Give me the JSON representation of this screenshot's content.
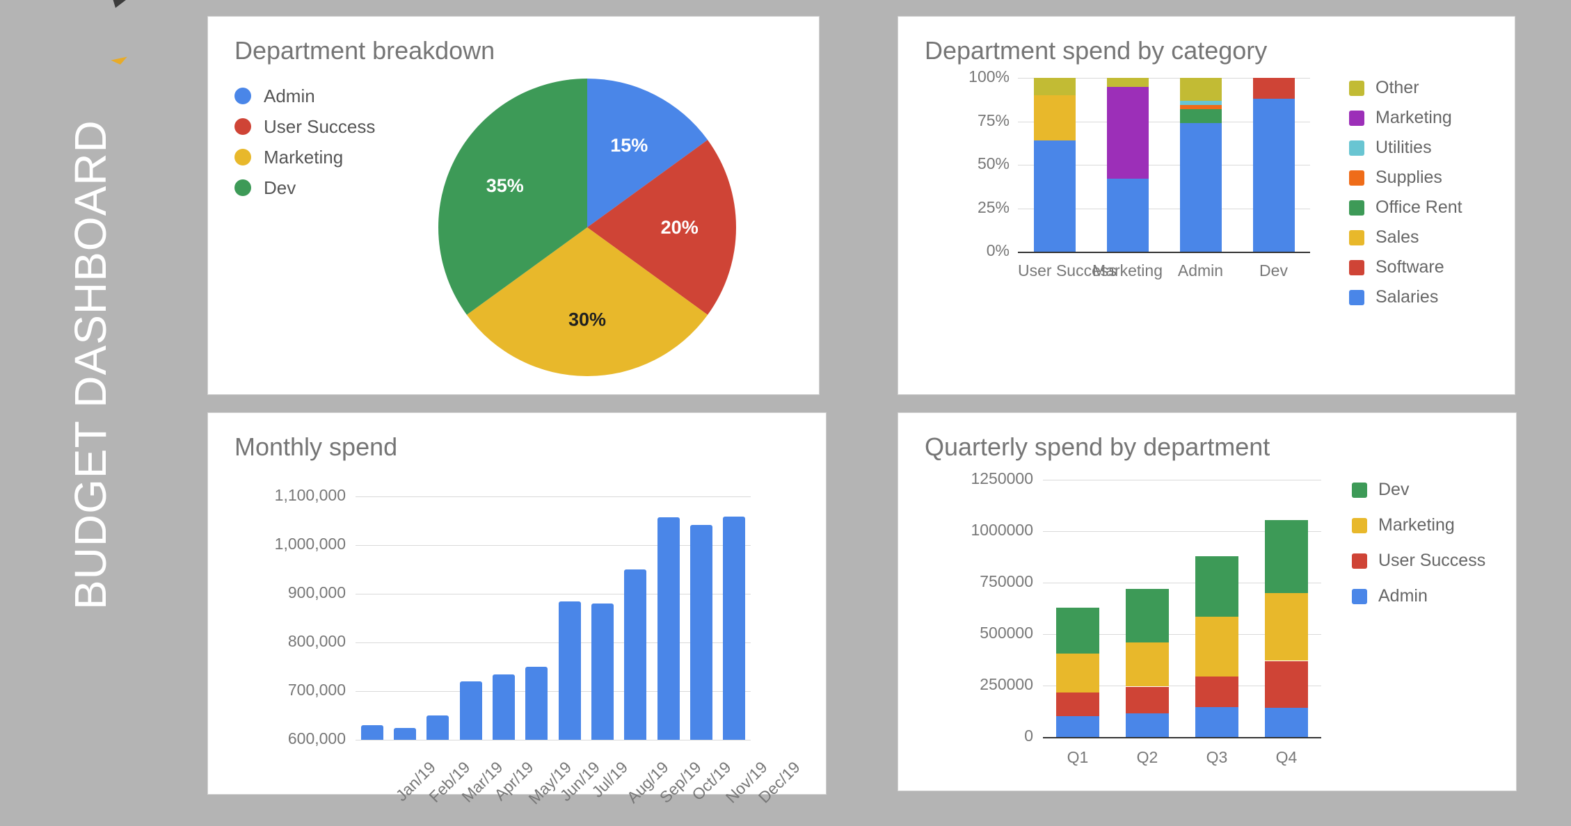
{
  "page": {
    "title": "BUDGET DASHBOARD",
    "background_color": "#b4b4b4",
    "card_background": "#ffffff"
  },
  "palette": {
    "blue": "#4a86e8",
    "red": "#cf4436",
    "yellow": "#e8b82b",
    "green": "#3d9a57",
    "purple": "#9c2fb8",
    "olive": "#c2bb34",
    "teal": "#69c5d2",
    "orange": "#ef6c19",
    "title_gray": "#757575",
    "tick_gray": "#777777"
  },
  "cards": {
    "pie": {
      "title": "Department breakdown"
    },
    "category": {
      "title": "Department spend by category"
    },
    "monthly": {
      "title": "Monthly spend"
    },
    "quarterly": {
      "title": "Quarterly spend by department"
    }
  },
  "chart_data": [
    {
      "id": "department-breakdown",
      "type": "pie",
      "title": "Department breakdown",
      "legend_position": "top-left",
      "categories": [
        "Admin",
        "User Success",
        "Marketing",
        "Dev"
      ],
      "values": [
        15,
        20,
        30,
        35
      ],
      "labels": [
        "15%",
        "20%",
        "30%",
        "35%"
      ],
      "colors": [
        "#4a86e8",
        "#cf4436",
        "#e8b82b",
        "#3d9a57"
      ],
      "label_colors": [
        "#ffffff",
        "#ffffff",
        "#202020",
        "#ffffff"
      ]
    },
    {
      "id": "department-spend-by-category",
      "type": "bar",
      "stacked": true,
      "title": "Department spend by category",
      "xlabel": "",
      "ylabel": "",
      "ylim": [
        0,
        100
      ],
      "yticks": [
        0,
        25,
        50,
        75,
        100
      ],
      "ytick_labels": [
        "0%",
        "25%",
        "50%",
        "75%",
        "100%"
      ],
      "grid": true,
      "legend_position": "right",
      "categories": [
        "User Success",
        "Marketing",
        "Admin",
        "Dev"
      ],
      "series": [
        {
          "name": "Salaries",
          "color": "#4a86e8",
          "values": [
            64,
            42,
            74,
            88
          ]
        },
        {
          "name": "Software",
          "color": "#cf4436",
          "values": [
            0,
            0,
            0,
            12
          ]
        },
        {
          "name": "Sales",
          "color": "#e8b82b",
          "values": [
            26,
            0,
            0,
            0
          ]
        },
        {
          "name": "Office Rent",
          "color": "#3d9a57",
          "values": [
            0,
            0,
            8,
            0
          ]
        },
        {
          "name": "Supplies",
          "color": "#ef6c19",
          "values": [
            0,
            0,
            2.5,
            0
          ]
        },
        {
          "name": "Utilities",
          "color": "#69c5d2",
          "values": [
            0,
            0,
            2.5,
            0
          ]
        },
        {
          "name": "Marketing",
          "color": "#9c2fb8",
          "values": [
            0,
            53,
            0,
            0
          ]
        },
        {
          "name": "Other",
          "color": "#c2bb34",
          "values": [
            10,
            5,
            13,
            0
          ]
        }
      ],
      "legend_entries": [
        "Other",
        "Marketing",
        "Utilities",
        "Supplies",
        "Office Rent",
        "Sales",
        "Software",
        "Salaries"
      ]
    },
    {
      "id": "monthly-spend",
      "type": "bar",
      "stacked": false,
      "title": "Monthly spend",
      "xlabel": "",
      "ylabel": "",
      "ylim": [
        600000,
        1100000
      ],
      "yticks": [
        600000,
        700000,
        800000,
        900000,
        1000000,
        1100000
      ],
      "ytick_labels": [
        "600,000",
        "700,000",
        "800,000",
        "900,000",
        "1,000,000",
        "1,100,000"
      ],
      "grid": true,
      "legend_position": "none",
      "bar_color": "#4a86e8",
      "categories": [
        "Jan/19",
        "Feb/19",
        "Mar/19",
        "Apr/19",
        "May/19",
        "Jun/19",
        "Jul/19",
        "Aug/19",
        "Sep/19",
        "Oct/19",
        "Nov/19",
        "Dec/19"
      ],
      "values": [
        630000,
        625000,
        650000,
        720000,
        735000,
        750000,
        885000,
        880000,
        950000,
        1057000,
        1042000,
        1058000
      ]
    },
    {
      "id": "quarterly-spend-by-department",
      "type": "bar",
      "stacked": true,
      "title": "Quarterly spend by department",
      "xlabel": "",
      "ylabel": "",
      "ylim": [
        0,
        1250000
      ],
      "yticks": [
        0,
        250000,
        500000,
        750000,
        1000000,
        1250000
      ],
      "ytick_labels": [
        "0",
        "250000",
        "500000",
        "750000",
        "1000000",
        "1250000"
      ],
      "grid": true,
      "legend_position": "right",
      "categories": [
        "Q1",
        "Q2",
        "Q3",
        "Q4"
      ],
      "series": [
        {
          "name": "Admin",
          "color": "#4a86e8",
          "values": [
            100000,
            115000,
            145000,
            143000
          ]
        },
        {
          "name": "User Success",
          "color": "#cf4436",
          "values": [
            115000,
            130000,
            150000,
            227000
          ]
        },
        {
          "name": "Marketing",
          "color": "#e8b82b",
          "values": [
            190000,
            215000,
            290000,
            330000
          ]
        },
        {
          "name": "Dev",
          "color": "#3d9a57",
          "values": [
            225000,
            260000,
            295000,
            355000
          ]
        }
      ],
      "legend_entries": [
        "Dev",
        "Marketing",
        "User Success",
        "Admin"
      ]
    }
  ]
}
